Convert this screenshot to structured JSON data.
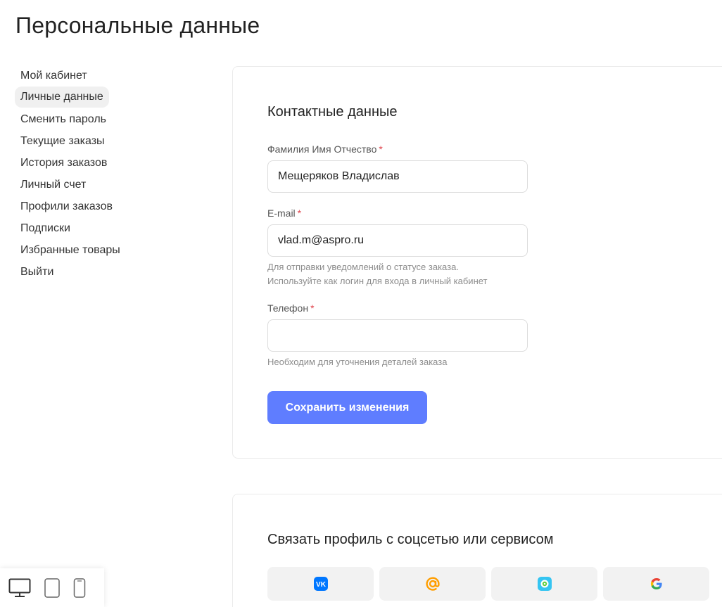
{
  "page": {
    "title": "Персональные данные"
  },
  "sidebar": {
    "items": [
      {
        "label": "Мой кабинет",
        "active": false
      },
      {
        "label": "Личные данные",
        "active": true
      },
      {
        "label": "Сменить пароль",
        "active": false
      },
      {
        "label": "Текущие заказы",
        "active": false
      },
      {
        "label": "История заказов",
        "active": false
      },
      {
        "label": "Личный счет",
        "active": false
      },
      {
        "label": "Профили заказов",
        "active": false
      },
      {
        "label": "Подписки",
        "active": false
      },
      {
        "label": "Избранные товары",
        "active": false
      },
      {
        "label": "Выйти",
        "active": false
      }
    ]
  },
  "contacts": {
    "title": "Контактные данные",
    "required_mark": "*",
    "name": {
      "label": "Фамилия Имя Отчество",
      "value": "Мещеряков Владислав"
    },
    "email": {
      "label": "E-mail",
      "value": "vlad.m@aspro.ru",
      "hint1": "Для отправки уведомлений о статусе заказа.",
      "hint2": "Используйте как логин для входа в личный кабинет"
    },
    "phone": {
      "label": "Телефон",
      "value": "",
      "hint": "Необходим для уточнения деталей заказа"
    },
    "save_label": "Сохранить изменения"
  },
  "social": {
    "title": "Связать профиль с соцсетью или сервисом",
    "services": [
      {
        "name": "vk-icon",
        "glyph": "VK",
        "color": "#0077ff"
      },
      {
        "name": "mail-ru-icon",
        "glyph": "@",
        "color": "#ff9e00"
      },
      {
        "name": "odnoklassniki-icon",
        "glyph": "",
        "color": "#35c5f2"
      },
      {
        "name": "google-icon",
        "glyph": "G",
        "color": "#4285f4"
      }
    ]
  },
  "devices": [
    {
      "name": "desktop-icon"
    },
    {
      "name": "tablet-icon"
    },
    {
      "name": "mobile-icon"
    }
  ],
  "colors": {
    "accent": "#5f7dff",
    "required": "#e0464e",
    "active_bg": "#f0f0f0"
  }
}
